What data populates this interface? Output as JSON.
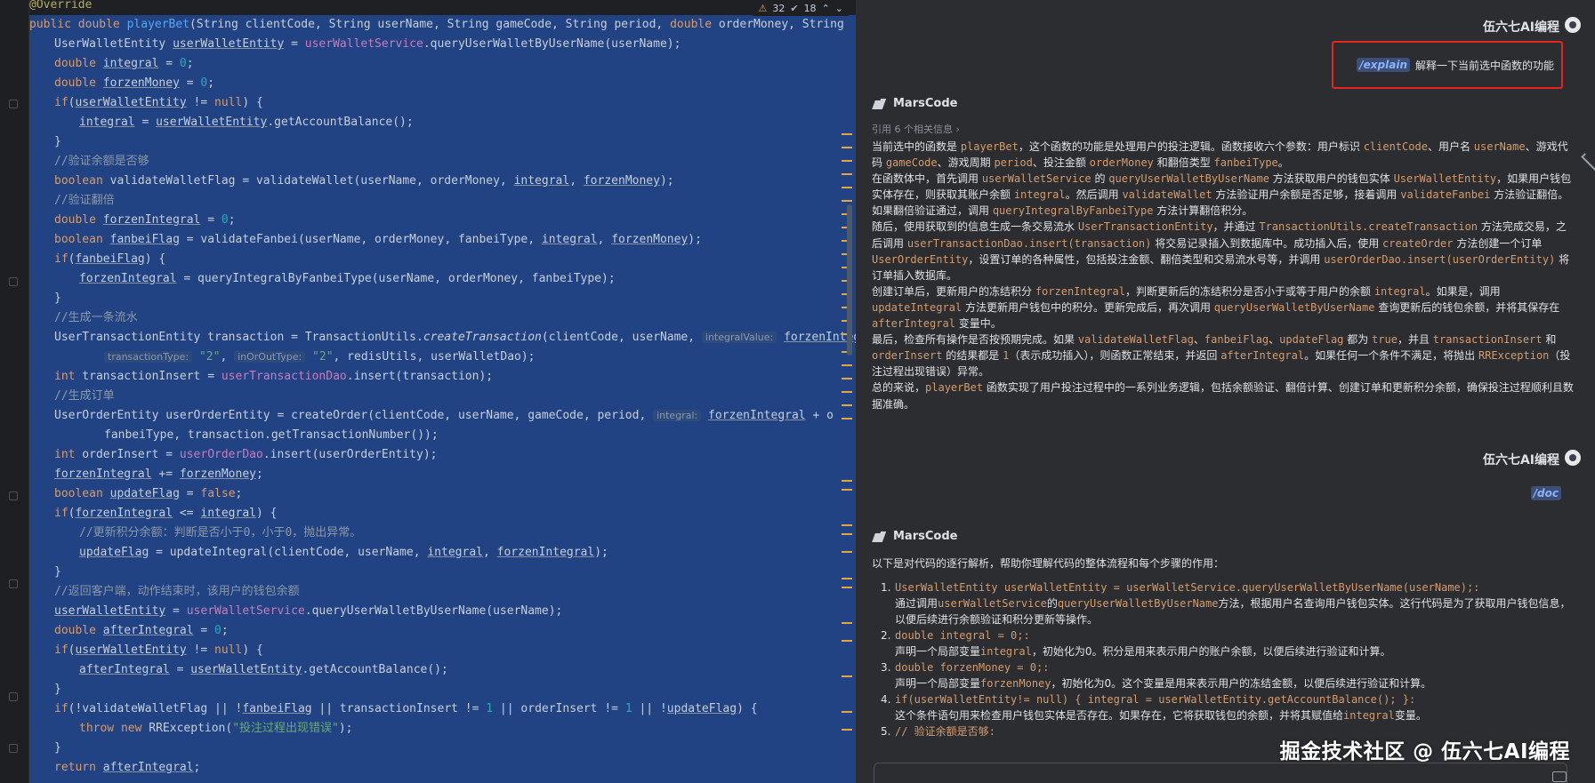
{
  "editor": {
    "inspections": {
      "warnings": "32",
      "weak_warnings": "18"
    },
    "inlay_hints": {
      "integral_value": "integralValue:",
      "transaction_type": "transactionType:",
      "in_or_out_type": "inOrOutType:",
      "integral": "integral:"
    },
    "lines": [
      "@Override",
      "public double playerBet(String clientCode, String userName, String gameCode, String period, double orderMoney, String",
      "UserWalletEntity userWalletEntity = userWalletService.queryUserWalletByUserName(userName);",
      "double integral = 0;",
      "double forzenMoney = 0;",
      "if(userWalletEntity != null) {",
      "integral = userWalletEntity.getAccountBalance();",
      "}",
      "//验证余额是否够",
      "boolean validateWalletFlag = validateWallet(userName, orderMoney, integral, forzenMoney);",
      "//验证翻倍",
      "double forzenIntegral = 0;",
      "boolean fanbeiFlag = validateFanbei(userName, orderMoney, fanbeiType, integral, forzenMoney);",
      "if(fanbeiFlag) {",
      "forzenIntegral = queryIntegralByFanbeiType(userName, orderMoney, fanbeiType);",
      "}",
      "//生成一条流水",
      "UserTransactionEntity transaction = TransactionUtils.createTransaction(clientCode, userName,",
      "\"2\", \"2\", redisUtils, userWalletDao);",
      "int transactionInsert = userTransactionDao.insert(transaction);",
      "//生成订单",
      "UserOrderEntity userOrderEntity = createOrder(clientCode, userName, gameCode, period,",
      "fanbeiType, transaction.getTransactionNumber());",
      "int orderInsert = userOrderDao.insert(userOrderEntity);",
      "forzenIntegral += forzenMoney;",
      "boolean updateFlag = false;",
      "if(forzenIntegral <= integral) {",
      "//更新积分余额：判断是否小于0，小于0，抛出异常。",
      "updateFlag = updateIntegral(clientCode, userName, integral, forzenIntegral);",
      "}",
      "//返回客户端，动作结束时，该用户的钱包余额",
      "userWalletEntity = userWalletService.queryUserWalletByUserName(userName);",
      "double afterIntegral = 0;",
      "if(userWalletEntity != null) {",
      "afterIntegral = userWalletEntity.getAccountBalance();",
      "}",
      "if(!validateWalletFlag || !fanbeiFlag || transactionInsert != 1 || orderInsert != 1 || !updateFlag) {",
      "throw new RRException(\"投注过程出现错误\");",
      "}",
      "return afterIntegral;"
    ]
  },
  "chat": {
    "user_name": "伍六七AI编程",
    "bot_name": "MarsCode",
    "message1": {
      "command": "/explain",
      "text": "解释一下当前选中函数的功能"
    },
    "references": "引用 6 个相关信息 ›",
    "answer1": [
      [
        "当前选中的函数是 ",
        "c:playerBet",
        "，这个函数的功能是处理用户的投注逻辑。函数接收六个参数：用户标识 ",
        "c:clientCode",
        "、用户名 ",
        "c:userName",
        "、游戏代码 ",
        "c:gameCode",
        "、游戏周期 ",
        "c:period",
        "、投注金额 ",
        "c:orderMoney",
        " 和翻倍类型 ",
        "c:fanbeiType",
        "。"
      ],
      [
        "在函数体中，首先调用 ",
        "c:userWalletService",
        " 的 ",
        "c:queryUserWalletByUserName",
        " 方法获取用户的钱包实体 ",
        "c:UserWalletEntity",
        "，如果用户钱包实体存在，则获取其账户余额 ",
        "c:integral",
        "。然后调用 ",
        "c:validateWallet",
        " 方法验证用户余额是否足够，接着调用 ",
        "c:validateFanbei",
        " 方法验证翻倍。如果翻倍验证通过，调用 ",
        "c:queryIntegralByFanbeiType",
        " 方法计算翻倍积分。"
      ],
      [
        "随后，使用获取到的信息生成一条交易流水 ",
        "c:UserTransactionEntity",
        "，并通过 ",
        "c:TransactionUtils.createTransaction",
        " 方法完成交易，之后调用 ",
        "c:userTransactionDao.insert(transaction)",
        " 将交易记录插入到数据库中。成功插入后，使用 ",
        "c:createOrder",
        " 方法创建一个订单 ",
        "c:UserOrderEntity",
        "，设置订单的各种属性，包括投注金额、翻倍类型和交易流水号等，并调用 ",
        "c:userOrderDao.insert(userOrderEntity)",
        " 将订单插入数据库。"
      ],
      [
        "创建订单后，更新用户的冻结积分 ",
        "c:forzenIntegral",
        "，判断更新后的冻结积分是否小于或等于用户的余额 ",
        "c:integral",
        "。如果是，调用 ",
        "c:updateIntegral",
        " 方法更新用户钱包中的积分。更新完成后，再次调用 ",
        "c:queryUserWalletByUserName",
        " 查询更新后的钱包余额，并将其保存在 ",
        "c:afterIntegral",
        " 变量中。"
      ],
      [
        "最后，检查所有操作是否按预期完成。如果 ",
        "c:validateWalletFlag",
        "、",
        "c:fanbeiFlag",
        "、",
        "c:updateFlag",
        " 都为 ",
        "c:true",
        "，并且 ",
        "c:transactionInsert",
        " 和 ",
        "c:orderInsert",
        " 的结果都是 ",
        "c:1",
        "（表示成功插入），则函数正常结束，并返回 ",
        "c:afterIntegral",
        "。如果任何一个条件不满足，将抛出 ",
        "c:RRException",
        "（投注过程出现错误）异常。"
      ],
      [
        "总的来说，",
        "c:playerBet",
        " 函数实现了用户投注过程中的一系列业务逻辑，包括余额验证、翻倍计算、创建订单和更新积分余额，确保投注过程顺利且数据准确。"
      ]
    ],
    "message2": {
      "command": "/doc"
    },
    "intro2": "以下是对代码的逐行解析，帮助你理解代码的整体流程和每个步骤的作用：",
    "steps": [
      {
        "n": "1.",
        "code": "UserWalletEntity userWalletEntity = userWalletService.queryUserWalletByUserName(userName);:",
        "desc": [
          "通过调用",
          "c:userWalletService",
          "的",
          "c:queryUserWalletByUserName",
          "方法，根据用户名查询用户钱包实体。这行代码是为了获取用户钱包信息，以便后续进行余额验证和积分更新等操作。"
        ]
      },
      {
        "n": "2.",
        "code": "double integral = 0;:",
        "desc": [
          "声明一个局部变量",
          "c:integral",
          "，初始化为0。积分是用来表示用户的账户余额，以便后续进行验证和计算。"
        ]
      },
      {
        "n": "3.",
        "code": "double forzenMoney = 0;:",
        "desc": [
          "声明一个局部变量",
          "c:forzenMoney",
          "，初始化为0。这个变量是用来表示用户的冻结金额，以便后续进行验证和计算。"
        ]
      },
      {
        "n": "4.",
        "code": "if(userWalletEntity!= null) { integral = userWalletEntity.getAccountBalance(); }:",
        "desc": [
          "这个条件语句用来检查用户钱包实体是否存在。如果存在，它将获取钱包的余额，并将其赋值给",
          "c:integral",
          "变量。"
        ]
      },
      {
        "n": "5.",
        "code": "// 验证余额是否够:",
        "desc": []
      }
    ],
    "watermark": "掘金技术社区 @ 伍六七AI编程"
  }
}
